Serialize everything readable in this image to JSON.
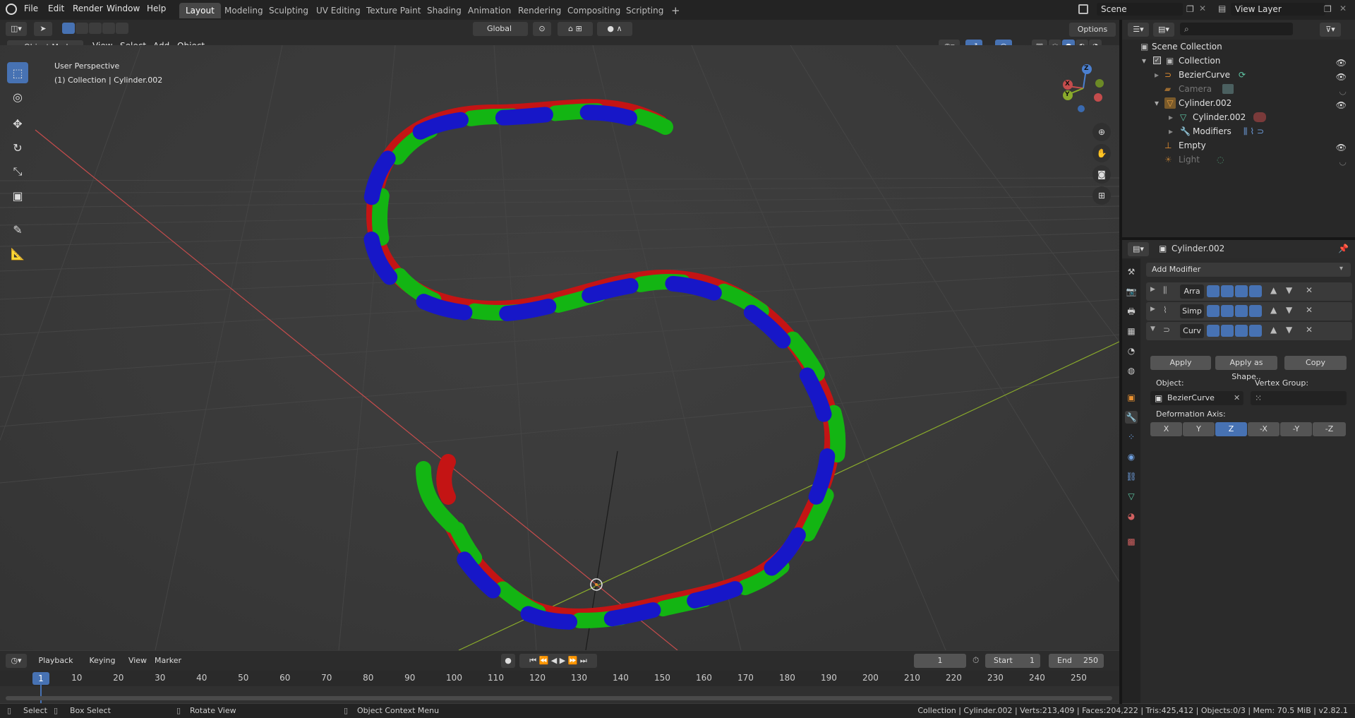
{
  "topbar": {
    "menus": [
      "File",
      "Edit",
      "Render",
      "Window",
      "Help"
    ],
    "workspaces": [
      "Layout",
      "Modeling",
      "Sculpting",
      "UV Editing",
      "Texture Paint",
      "Shading",
      "Animation",
      "Rendering",
      "Compositing",
      "Scripting"
    ],
    "add_tab": "+",
    "scene": "Scene",
    "view_layer": "View Layer"
  },
  "viewport_header": {
    "mode": "Object Mode",
    "menus": [
      "View",
      "Select",
      "Add",
      "Object"
    ],
    "orientation": "Global",
    "options": "Options"
  },
  "viewport": {
    "perspective": "User Perspective",
    "context": "(1) Collection | Cylinder.002",
    "gizmo": {
      "x": "X",
      "y": "Y",
      "z": "Z"
    },
    "tools": [
      "select-box-icon",
      "cursor-icon",
      "move-icon",
      "rotate-icon",
      "scale-icon",
      "transform-icon",
      "annotate-icon",
      "measure-icon"
    ]
  },
  "outliner": {
    "search": "",
    "rows": [
      {
        "label": "Scene Collection",
        "indent": 0,
        "dim": false,
        "eye": false
      },
      {
        "label": "Collection",
        "indent": 1,
        "dim": false,
        "eye": true
      },
      {
        "label": "BezierCurve",
        "indent": 2,
        "dim": false,
        "eye": true
      },
      {
        "label": "Camera",
        "indent": 2,
        "dim": true,
        "eye": false
      },
      {
        "label": "Cylinder.002",
        "indent": 2,
        "dim": false,
        "eye": true
      },
      {
        "label": "Cylinder.002",
        "indent": 3,
        "dim": false,
        "eye": false
      },
      {
        "label": "Modifiers",
        "indent": 3,
        "dim": false,
        "eye": false
      },
      {
        "label": "Empty",
        "indent": 2,
        "dim": false,
        "eye": true
      },
      {
        "label": "Light",
        "indent": 2,
        "dim": true,
        "eye": false
      }
    ]
  },
  "properties": {
    "object": "Cylinder.002",
    "add_modifier": "Add Modifier",
    "modifiers": [
      "Arra",
      "Simp",
      "Curv"
    ],
    "apply": "Apply",
    "apply_shape": "Apply as Shape..",
    "copy": "Copy",
    "object_label": "Object:",
    "object_value": "BezierCurve",
    "vertex_group_label": "Vertex Group:",
    "axis_label": "Deformation Axis:",
    "axes": [
      "X",
      "Y",
      "Z",
      "-X",
      "-Y",
      "-Z"
    ],
    "axis_selected": "Z"
  },
  "timeline": {
    "menus": [
      "Playback",
      "Keying",
      "View",
      "Marker"
    ],
    "current_frame": "1",
    "start_label": "Start",
    "start": "1",
    "end_label": "End",
    "end": "250",
    "ticks": [
      "1",
      "10",
      "20",
      "30",
      "40",
      "50",
      "60",
      "70",
      "80",
      "90",
      "100",
      "110",
      "120",
      "130",
      "140",
      "150",
      "160",
      "170",
      "180",
      "190",
      "200",
      "210",
      "220",
      "230",
      "240",
      "250"
    ]
  },
  "statusbar": {
    "select": "Select",
    "box_select": "Box Select",
    "rotate_view": "Rotate View",
    "context_menu": "Object Context Menu",
    "stats": "Collection | Cylinder.002 | Verts:213,409 | Faces:204,222 | Tris:425,412 | Objects:0/3 | Mem: 70.5 MiB | v2.82.1"
  },
  "colors": {
    "accent": "#4772b3",
    "rope_red": "#c41414",
    "rope_green": "#13b513",
    "rope_blue": "#1717c8",
    "x_axis": "#c44c4c",
    "y_axis": "#8aab2b"
  }
}
